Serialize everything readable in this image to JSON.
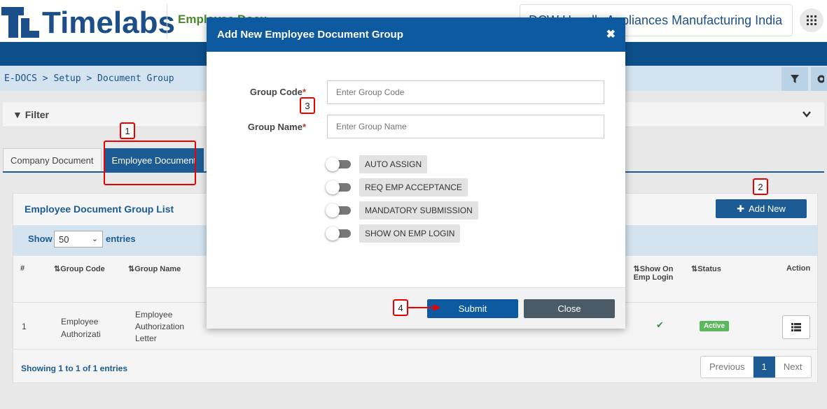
{
  "header": {
    "logo_text": "Timelabs",
    "module_title": "Employee Docu",
    "company": "DCW Havells Appliances Manufacturing India"
  },
  "breadcrumb": "E-DOCS > Setup > Document Group",
  "filter": {
    "label": "Filter"
  },
  "tabs": [
    {
      "label": "Company Document"
    },
    {
      "label": "Employee Document"
    }
  ],
  "panel": {
    "title": "Employee Document Group List",
    "add_new": "Add New",
    "show_label": "Show",
    "show_value": "50",
    "entries_label": "entries",
    "columns": [
      "#",
      "Group Code",
      "Group Name",
      "Show On Emp Login",
      "Status",
      "Action"
    ],
    "rows": [
      {
        "index": "1",
        "group_code": "Employee Authorizati",
        "group_name": "Employee Authorization Letter",
        "status": "Active"
      }
    ],
    "footer_info": "Showing 1 to 1 of 1 entries",
    "pager": {
      "prev": "Previous",
      "page": "1",
      "next": "Next"
    }
  },
  "modal": {
    "title": "Add New Employee Document Group",
    "close": "✖",
    "fields": {
      "group_code_label": "Group Code",
      "group_code_placeholder": "Enter Group Code",
      "group_name_label": "Group Name",
      "group_name_placeholder": "Enter Group Name",
      "required_mark": "*"
    },
    "toggles": [
      {
        "label": "AUTO ASSIGN",
        "on": false
      },
      {
        "label": "REQ EMP ACCEPTANCE",
        "on": false
      },
      {
        "label": "MANDATORY SUBMISSION",
        "on": false
      },
      {
        "label": "SHOW ON EMP LOGIN",
        "on": false
      }
    ],
    "submit": "Submit",
    "close_button": "Close"
  },
  "markers": [
    "1",
    "2",
    "3",
    "4"
  ],
  "colors": {
    "brand": "#0d5aa0",
    "navbar": "#0d4f8b",
    "active": "#5cb85c",
    "annotation": "#e00000"
  }
}
